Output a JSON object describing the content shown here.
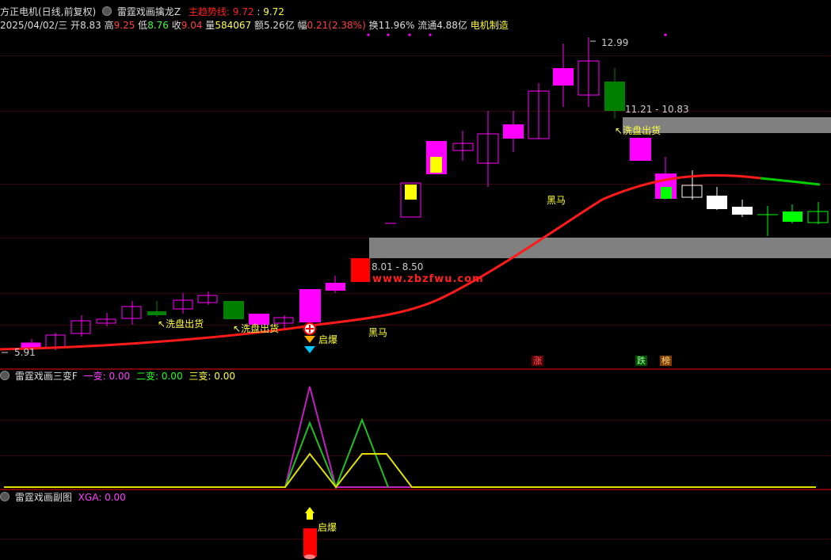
{
  "main_chart": {
    "title": "方正电机(日线,前复权)",
    "indicator_name": "雷霆戏画擒龙Z",
    "indicator_line_label": "主趋势线:",
    "indicator_line_value1": "9.72",
    "indicator_line_value2": "9.72",
    "info": {
      "date": "2025/04/02/三",
      "open_label": "开",
      "open": "8.83",
      "high_label": "高",
      "high": "9.25",
      "low_label": "低",
      "low": "8.76",
      "close_label": "收",
      "close": "9.04",
      "vol_label": "量",
      "vol": "584067",
      "amount_label": "额",
      "amount": "5.26亿",
      "change_label": "幅",
      "change": "0.21(2.38%)",
      "turnover_label": "换",
      "turnover": "11.96%",
      "float_label": "流通",
      "float": "4.88亿",
      "sector": "电机制造"
    },
    "annotations": {
      "high_price": "12.99",
      "low_price": "5.91",
      "resistance_zone": "11.21 - 10.83",
      "support_zone": "8.01 - 8.50",
      "wash_1": "洗盘出货",
      "wash_2": "洗盘出货",
      "wash_3": "洗盘出货",
      "dark_horse_1": "黑马",
      "dark_horse_2": "黑马",
      "qibao": "启爆",
      "watermark": "www.zbzfwu.com",
      "badge_rise": "涨",
      "badge_fall": "跌",
      "badge_list": "榜"
    },
    "colors": {
      "up": "#ff00ff",
      "down": "#008000",
      "trend": "#ff1a1a",
      "trend_tail": "#00cc00"
    }
  },
  "sub1": {
    "name": "雷霆戏画三变F",
    "l1_label": "一变:",
    "l1_value": "0.00",
    "l2_label": "二变:",
    "l2_value": "0.00",
    "l3_label": "三变:",
    "l3_value": "0.00"
  },
  "sub2": {
    "name": "雷霆戏画副图",
    "xga_label": "XGA:",
    "xga_value": "0.00",
    "qibao": "启爆"
  }
}
